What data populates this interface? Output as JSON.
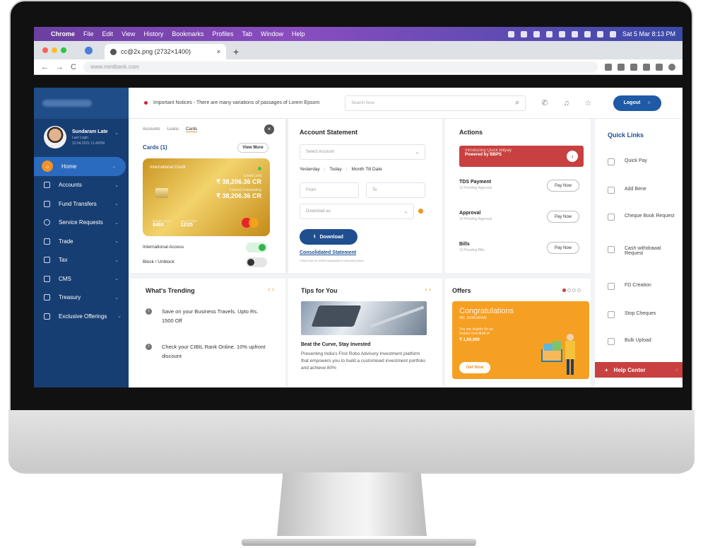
{
  "menubar": {
    "apple_icon": "apple-icon",
    "items": [
      "Chrome",
      "File",
      "Edit",
      "View",
      "History",
      "Bookmarks",
      "Profiles",
      "Tab",
      "Window",
      "Help"
    ],
    "clock": "Sat 5 Mar  8:13 PM"
  },
  "browser": {
    "tab_title": "cc@2x.png (2732×1400)",
    "tab_close": "×",
    "new_tab": "+",
    "url": "www.mintbank.com"
  },
  "topbar": {
    "notice": "Important Notices - There are many variations of passages of Lorem Epsom",
    "search_placeholder": "Search here",
    "logout_label": "Logout"
  },
  "profile": {
    "name": "Sundaram Late",
    "last_login_label": "Last Login",
    "last_login": "12.04.2021 11:45PM"
  },
  "nav": [
    {
      "label": "Home",
      "icon": "home-icon",
      "active": true
    },
    {
      "label": "Accounts",
      "icon": "accounts-icon"
    },
    {
      "label": "Fund Transfers",
      "icon": "transfer-icon"
    },
    {
      "label": "Service Requests",
      "icon": "service-icon"
    },
    {
      "label": "Trade",
      "icon": "trade-icon"
    },
    {
      "label": "Tax",
      "icon": "tax-icon"
    },
    {
      "label": "CMS",
      "icon": "cms-icon"
    },
    {
      "label": "Treasury",
      "icon": "treasury-icon"
    },
    {
      "label": "Exclusive Offerings",
      "icon": "offerings-icon"
    }
  ],
  "cards_panel": {
    "tabs": [
      "Accounts",
      "Loans",
      "Cards"
    ],
    "title": "Cards (1)",
    "view_more": "View More",
    "card": {
      "type": "International Credit",
      "credit_limit_label": "Credit Limit",
      "credit_limit": "₹ 38,206.36 CR",
      "outstanding_label": "Current Outstanding",
      "outstanding": "₹ 38,206.36 CR",
      "number_label": "ENDED WITH",
      "number": "8493",
      "valid_label": "VALID THRU",
      "valid": "12/25"
    },
    "international_access": "International Access",
    "block_unblock": "Block / Unblock"
  },
  "statement": {
    "title": "Account Statement",
    "select_account": "Select Account",
    "ranges": [
      "Yesterday",
      "Today",
      "Month Till Date"
    ],
    "from": "From",
    "to": "To",
    "download_as": "Download as",
    "download_button": "Download",
    "consolidated": "Consolidated Statement",
    "consolidated_note": "*Click here for 10000 transaction in selected period"
  },
  "actions": {
    "title": "Actions",
    "banner_line1": "Introducing Quick Billpay",
    "banner_line2": "Powered by BBPS",
    "rows": [
      {
        "title": "TDS Payment",
        "sub": "10 Pending Approval",
        "button": "Pay Now"
      },
      {
        "title": "Approval",
        "sub": "10 Pending Approval",
        "button": "Pay Now"
      },
      {
        "title": "Bills",
        "sub": "10 Pending Bills",
        "button": "Pay Now"
      }
    ]
  },
  "quick_links": {
    "title": "Quick Links",
    "items": [
      {
        "label": "Quick Pay",
        "icon": "quick-pay-icon"
      },
      {
        "label": "Add Bene",
        "icon": "add-bene-icon"
      },
      {
        "label": "Cheque Book Request",
        "icon": "cheque-book-icon"
      },
      {
        "label": "Cash withdrawal Request",
        "icon": "cash-withdrawal-icon"
      },
      {
        "label": "FD Creation",
        "icon": "fd-icon"
      },
      {
        "label": "Stop Cheques",
        "icon": "stop-cheque-icon"
      },
      {
        "label": "Bulk Upload",
        "icon": "bulk-upload-icon"
      }
    ],
    "help_center": "Help Center"
  },
  "trending": {
    "title": "What's Trending",
    "items": [
      "Save on your Business Travels. Upto Rs. 1500 Off",
      "Check your CIBIL Rank Online. 10% upfront discount"
    ]
  },
  "tips": {
    "title": "Tips for You",
    "headline": "Beat the Curve, Stay Invested",
    "body": "Presenting India's First Robo Advisory Investment platform that empowers you to build a customised investment portfolio and achieve 80%"
  },
  "offers": {
    "title": "Offers",
    "congrats": "Congratulations",
    "name": "MR. SUNDARAN",
    "line1": "You are eligible for an",
    "line2": "Instant Overdraft of",
    "amount": "₹ 1,00,000",
    "button": "Get Now"
  },
  "colors": {
    "navy": "#173e72",
    "accent_orange": "#f29226",
    "red": "#c8403f",
    "blue": "#1f5aa6"
  }
}
